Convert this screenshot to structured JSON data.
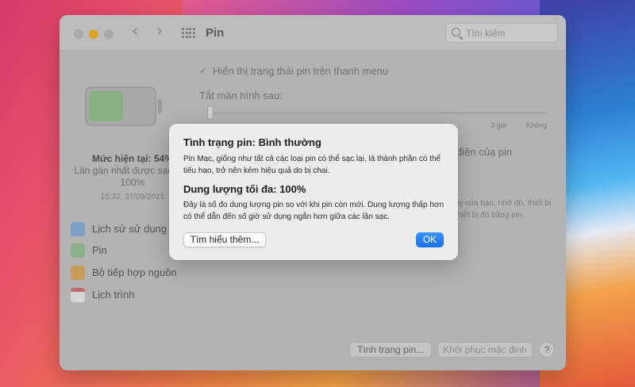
{
  "window": {
    "title": "Pin",
    "search_placeholder": "Tìm kiếm"
  },
  "battery": {
    "level_percent": 54,
    "level_text": "Mức hiện tại: 54%",
    "last_charge_text": "Lần gần nhất được sạc đến 100%",
    "last_charge_time": "15:32, 27/09/2021"
  },
  "sidebar": {
    "items": [
      {
        "label": "Lịch sử sử dụng",
        "icon": "chart-icon"
      },
      {
        "label": "Pin",
        "icon": "battery-icon"
      },
      {
        "label": "Bộ tiếp hợp nguồn",
        "icon": "power-adapter-icon"
      },
      {
        "label": "Lịch trình",
        "icon": "calendar-icon"
      }
    ]
  },
  "content": {
    "show_in_menu_bar_label": "Hiển thị trạng thái pin trên thanh menu",
    "show_in_menu_bar_checked": true,
    "turn_off_display_label": "Tắt màn hình sau:",
    "tick_3h": "3 giờ",
    "tick_never": "Không",
    "partial_text_1": "điện của pin",
    "partial_text_2a": "ấy của bạn, nhờ đó, thiết bị",
    "partial_text_2b": "thiết bị đó bằng pin."
  },
  "buttons": {
    "battery_health": "Tình trạng pin...",
    "restore_defaults": "Khôi phục mặc định",
    "help": "?"
  },
  "dialog": {
    "title_health": "Tình trạng pin: Bình thường",
    "text_health": "Pin Mac, giống như tất cả các loại pin có thể sạc lại, là thành phần có thể tiêu hao, trở nên kém hiệu quả do bị chai.",
    "title_capacity": "Dung lượng tối đa: 100%",
    "text_capacity": "Đây là số đo dung lượng pin so với khi pin còn mới. Dung lượng thấp hơn có thể dẫn đến số giờ sử dụng ngắn hơn giữa các lần sạc.",
    "learn_more": "Tìm hiểu thêm...",
    "ok": "OK"
  },
  "colors": {
    "ok_button": "#1a72e8",
    "battery_fill": "#88b083",
    "minimize_dot": "#d9a62c"
  }
}
